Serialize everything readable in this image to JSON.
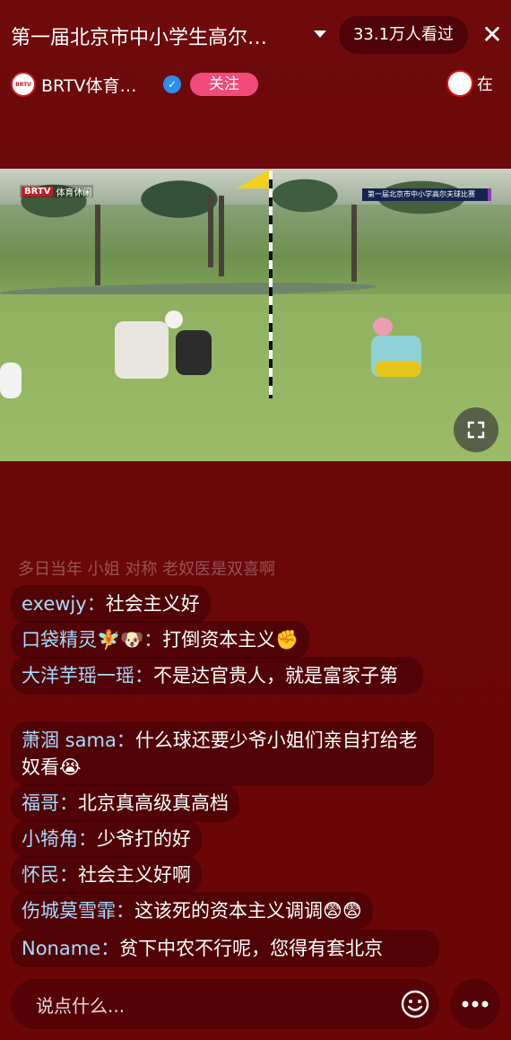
{
  "header": {
    "title": "第一届北京市中小学生高尔…",
    "viewers": "33.1万人看过",
    "close_glyph": "✕"
  },
  "channel": {
    "logo_text": "BRTV",
    "name": "BRTV体育…",
    "follow_label": "关注",
    "right_chip_text": "在"
  },
  "video": {
    "channel_badge_logo": "BRTV",
    "channel_badge_text": "体育休闲",
    "event_badge_text": "第一届北京市中小学高尔夫球比赛"
  },
  "chat": {
    "faded_line": "多日当年 小姐 对称 老奴医是双喜啊",
    "messages": [
      {
        "user": "exewjy：",
        "text": "社会主义好"
      },
      {
        "user": "口袋精灵🧚🐶：",
        "text": "打倒资本主义✊"
      },
      {
        "user": "大洋芋瑶一瑶：",
        "text": "不是达官贵人，就是富家子第"
      },
      {
        "user": "萧涸 sama：",
        "text": "什么球还要少爷小姐们亲自打给老奴看😭"
      },
      {
        "user": "福哥：",
        "text": "北京真高级真高档"
      },
      {
        "user": "小犄角：",
        "text": "少爷打的好"
      },
      {
        "user": "怀民：",
        "text": "社会主义好啊"
      },
      {
        "user": "伤城莫雪霏：",
        "text": "这该死的资本主义调调😨😨"
      },
      {
        "user": "Noname：",
        "text": "贫下中农不行呢，您得有套北京"
      }
    ]
  },
  "input": {
    "placeholder": "说点什么..."
  },
  "colors": {
    "background": "#6b0608",
    "follow_button": "#f14b7c",
    "username": "#a6dcff",
    "verified": "#2a8ff0"
  }
}
